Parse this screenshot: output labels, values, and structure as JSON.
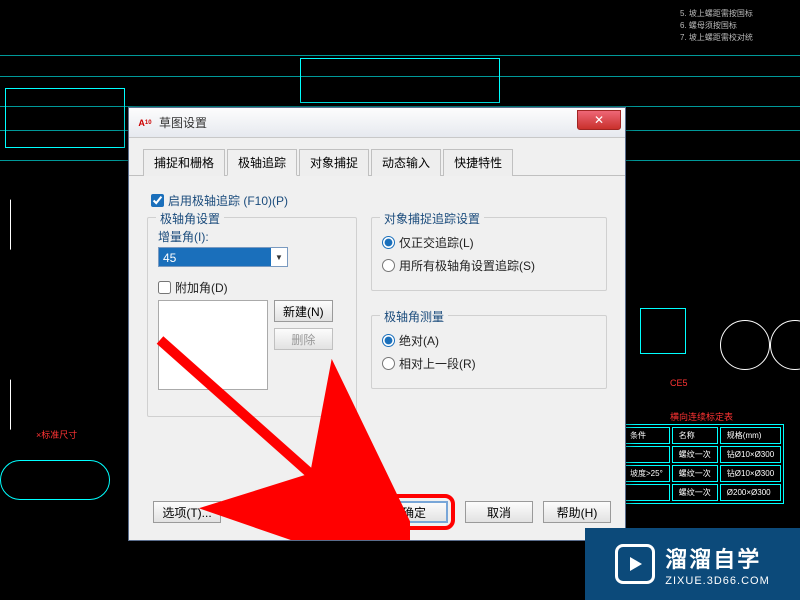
{
  "dialog": {
    "title": "草图设置",
    "tabs": [
      "捕捉和栅格",
      "极轴追踪",
      "对象捕捉",
      "动态输入",
      "快捷特性"
    ],
    "active_tab_index": 1,
    "enable_polar": {
      "label": "启用极轴追踪 (F10)(P)",
      "checked": true
    },
    "polar_angle_group": {
      "legend": "极轴角设置",
      "increment_label": "增量角(I):",
      "increment_value": "45",
      "additional_angle": {
        "label": "附加角(D)",
        "checked": false
      },
      "new_btn": "新建(N)",
      "delete_btn": "删除"
    },
    "snap_track_group": {
      "legend": "对象捕捉追踪设置",
      "ortho_label": "仅正交追踪(L)",
      "all_label": "用所有极轴角设置追踪(S)",
      "selected": "ortho"
    },
    "measure_group": {
      "legend": "极轴角测量",
      "absolute_label": "绝对(A)",
      "relative_label": "相对上一段(R)",
      "selected": "absolute"
    },
    "footer": {
      "options_btn": "选项(T)...",
      "ok_btn": "确定",
      "cancel_btn": "取消",
      "help_btn": "帮助(H)"
    }
  },
  "watermark": {
    "main": "溜溜自学",
    "sub": "ZIXUE.3D66.COM"
  },
  "bg_table": {
    "headers": [
      "条件",
      "名称",
      "规格(mm)"
    ],
    "rows": [
      [
        "",
        "螺纹一次",
        "钻Ø10×Ø300"
      ],
      [
        "坡度>25°",
        "螺纹一次",
        "钻Ø10×Ø300"
      ],
      [
        "",
        "螺纹一次",
        "Ø200×Ø300"
      ]
    ]
  },
  "bg_notes": [
    "5. 坡上螺距需按国标",
    "6. 螺母须按国标",
    "7. 坡上螺距需校对统"
  ]
}
